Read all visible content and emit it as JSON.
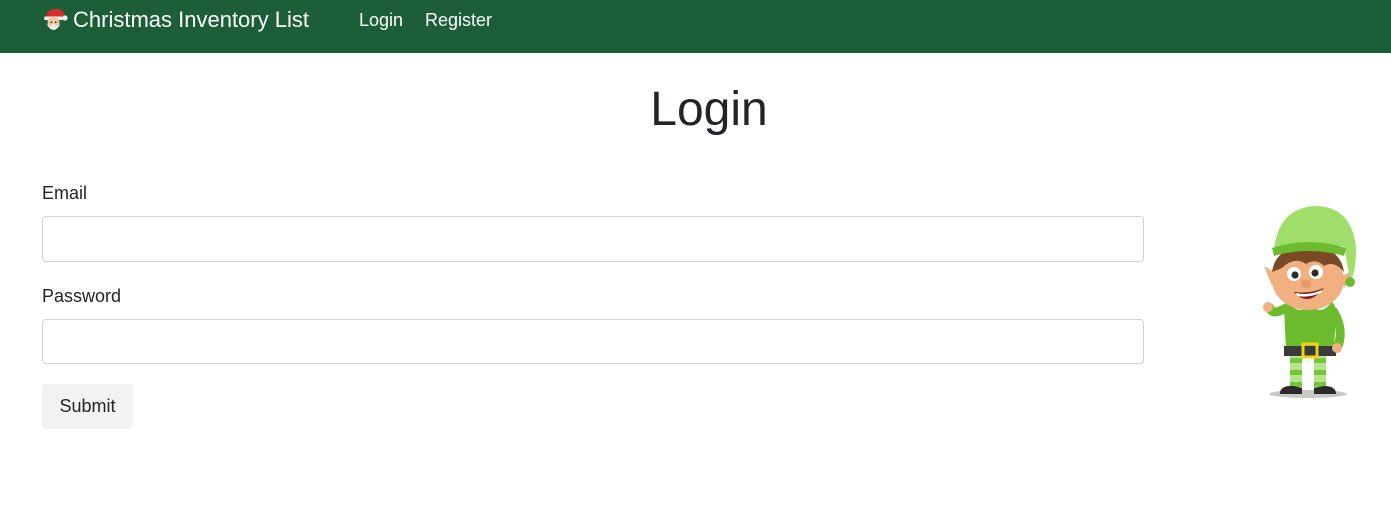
{
  "navbar": {
    "brand_icon": "santa-icon",
    "brand_label": "Christmas Inventory List",
    "links": [
      {
        "label": "Login"
      },
      {
        "label": "Register"
      }
    ],
    "background_color": "#1b5e38"
  },
  "main": {
    "title": "Login",
    "form": {
      "email_label": "Email",
      "email_value": "",
      "password_label": "Password",
      "password_value": "",
      "submit_label": "Submit"
    },
    "illustration": "elf-illustration"
  }
}
